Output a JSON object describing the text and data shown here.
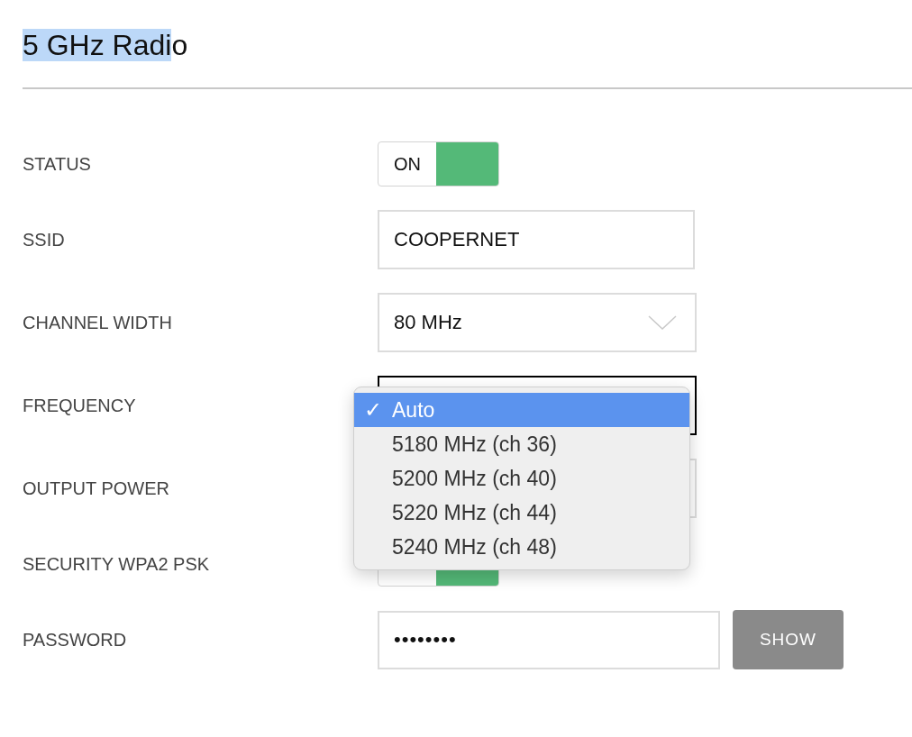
{
  "title": {
    "selected_text": "5 GHz Radi",
    "rest": "o"
  },
  "fields": [
    {
      "label": "STATUS",
      "kind": "toggle",
      "on": true,
      "text": "ON"
    },
    {
      "label": "SSID",
      "kind": "text",
      "value": "COOPERNET"
    },
    {
      "label": "CHANNEL WIDTH",
      "kind": "select",
      "value": "80 MHz",
      "focused": false
    },
    {
      "label": "FREQUENCY",
      "kind": "select",
      "focused": true
    },
    {
      "label": "OUTPUT POWER",
      "kind": "select",
      "focused": false
    },
    {
      "label": "SECURITY WPA2 PSK",
      "kind": "toggle",
      "on": true
    },
    {
      "label": "PASSWORD",
      "kind": "password",
      "value": "••••••••",
      "button": "SHOW"
    }
  ],
  "frequency_menu": [
    {
      "label": "Auto",
      "selected": true,
      "check": "✓"
    },
    {
      "label": "5180 MHz (ch 36)",
      "selected": false
    },
    {
      "label": "5200 MHz (ch 40)",
      "selected": false
    },
    {
      "label": "5220 MHz (ch 44)",
      "selected": false
    },
    {
      "label": "5240 MHz (ch 48)",
      "selected": false
    }
  ]
}
